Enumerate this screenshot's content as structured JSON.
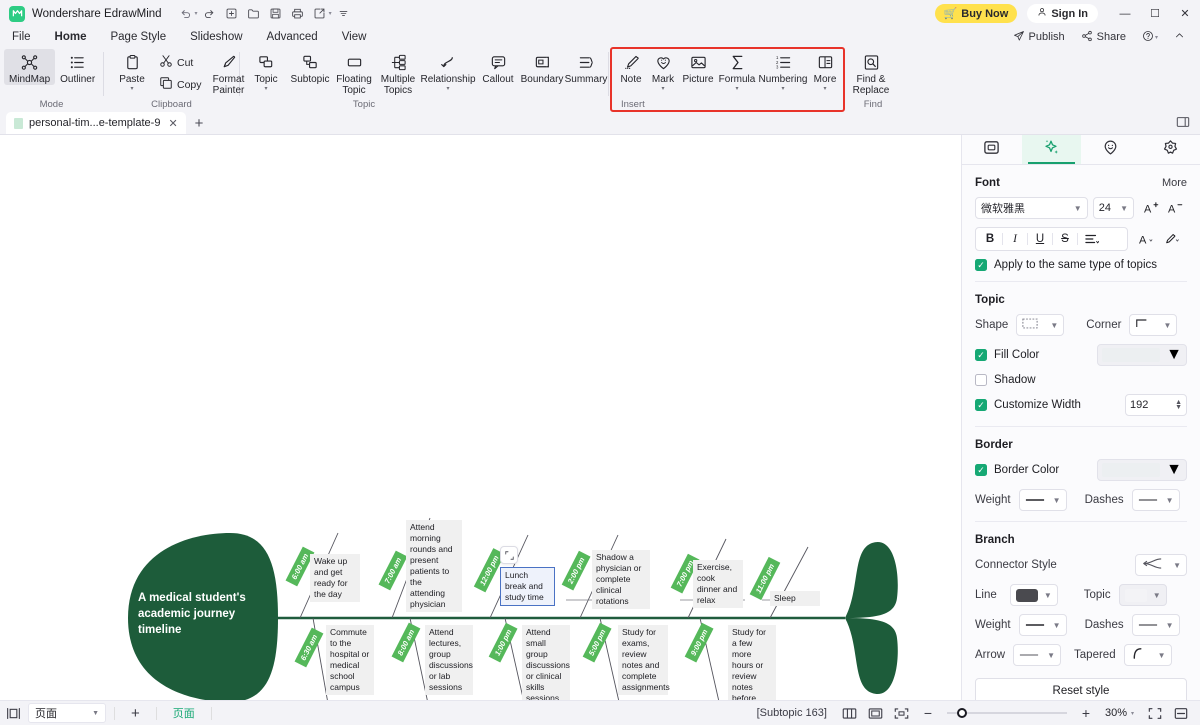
{
  "titlebar": {
    "logo_text": "M",
    "app_title": "Wondershare EdrawMind",
    "qat": [
      {
        "name": "undo-icon",
        "glyph": "↶"
      },
      {
        "name": "undo-dropdown-icon",
        "glyph": "▾"
      },
      {
        "name": "redo-icon",
        "glyph": "↷"
      },
      {
        "name": "new-icon",
        "glyph": "⊞"
      },
      {
        "name": "open-icon",
        "glyph": "🗁"
      },
      {
        "name": "save-icon",
        "glyph": "🖫"
      },
      {
        "name": "print-icon",
        "glyph": "🖶"
      },
      {
        "name": "export-icon",
        "glyph": "↗"
      },
      {
        "name": "export-dropdown-icon",
        "glyph": "▾"
      },
      {
        "name": "qat-more-icon",
        "glyph": "⩲"
      }
    ],
    "buy_now": "Buy Now",
    "sign_in": "Sign In",
    "minimize": "—",
    "maximize": "☐",
    "close": "✕"
  },
  "menubar": {
    "items": [
      {
        "label": "File",
        "active": false
      },
      {
        "label": "Home",
        "active": true
      },
      {
        "label": "Page Style",
        "active": false
      },
      {
        "label": "Slideshow",
        "active": false
      },
      {
        "label": "Advanced",
        "active": false
      },
      {
        "label": "View",
        "active": false
      }
    ],
    "right": [
      {
        "label": "Publish",
        "icon": "publish-icon"
      },
      {
        "label": "Share",
        "icon": "share-icon"
      },
      {
        "label": "",
        "icon": "help-icon"
      },
      {
        "label": "",
        "icon": "collapse-ribbon-icon"
      }
    ]
  },
  "ribbon": {
    "groups": [
      {
        "label": "Mode",
        "buttons": [
          {
            "label": "MindMap",
            "icon": "mindmap-icon",
            "active": true
          },
          {
            "label": "Outliner",
            "icon": "outliner-icon",
            "active": false
          }
        ]
      },
      {
        "label": "Clipboard",
        "buttons": [
          {
            "label": "Paste",
            "icon": "paste-icon",
            "dropdown": true
          },
          {
            "label": "Cut",
            "icon": "cut-icon"
          },
          {
            "label": "Copy",
            "icon": "copy-icon"
          },
          {
            "label": "Format Painter",
            "icon": "format-painter-icon"
          }
        ]
      },
      {
        "label": "Topic",
        "buttons": [
          {
            "label": "Topic",
            "icon": "topic-icon",
            "dropdown": true
          },
          {
            "label": "Subtopic",
            "icon": "subtopic-icon"
          },
          {
            "label": "Floating Topic",
            "icon": "floating-topic-icon"
          },
          {
            "label": "Multiple Topics",
            "icon": "multiple-topics-icon"
          },
          {
            "label": "Relationship",
            "icon": "relationship-icon",
            "dropdown": true
          },
          {
            "label": "Callout",
            "icon": "callout-icon"
          },
          {
            "label": "Boundary",
            "icon": "boundary-icon"
          },
          {
            "label": "Summary",
            "icon": "summary-icon"
          }
        ]
      },
      {
        "label": "Insert",
        "highlighted": true,
        "buttons": [
          {
            "label": "Note",
            "icon": "note-icon"
          },
          {
            "label": "Mark",
            "icon": "mark-icon",
            "dropdown": true
          },
          {
            "label": "Picture",
            "icon": "picture-icon"
          },
          {
            "label": "Formula",
            "icon": "formula-icon",
            "dropdown": true
          },
          {
            "label": "Numbering",
            "icon": "numbering-icon",
            "dropdown": true
          },
          {
            "label": "More",
            "icon": "more-icon",
            "dropdown": true
          }
        ]
      },
      {
        "label": "Find",
        "buttons": [
          {
            "label": "Find & Replace",
            "icon": "find-replace-icon"
          }
        ]
      }
    ]
  },
  "doctabs": {
    "tabs": [
      {
        "label": "personal-tim...e-template-9",
        "close": "✕"
      }
    ],
    "add": "+",
    "right_panel_toggle": "panel-toggle-icon"
  },
  "panel": {
    "tabs": [
      {
        "name": "layout-tab",
        "icon": "layout-icon",
        "active": false
      },
      {
        "name": "style-tab",
        "icon": "sparkle-icon",
        "active": true
      },
      {
        "name": "mark-tab",
        "icon": "smiley-icon",
        "active": false
      },
      {
        "name": "theme-tab",
        "icon": "flower-icon",
        "active": false
      }
    ],
    "font": {
      "title": "Font",
      "more": "More",
      "family": "微软雅黑",
      "size": "24",
      "increase_label": "A",
      "decrease_label": "A",
      "bold": "B",
      "italic": "I",
      "underline": "U",
      "strike": "S",
      "align": "≡",
      "text_color": "A",
      "highlight": "✏",
      "apply_same_label": "Apply to the same type of topics",
      "apply_same_checked": true
    },
    "topic": {
      "title": "Topic",
      "shape_label": "Shape",
      "corner_label": "Corner",
      "fill_color_label": "Fill Color",
      "fill_color_checked": true,
      "shadow_label": "Shadow",
      "shadow_checked": false,
      "customize_width_label": "Customize Width",
      "customize_width_checked": true,
      "width_value": "192"
    },
    "border": {
      "title": "Border",
      "border_color_label": "Border Color",
      "border_color_checked": true,
      "weight_label": "Weight",
      "dashes_label": "Dashes"
    },
    "branch": {
      "title": "Branch",
      "connector_style_label": "Connector Style",
      "line_label": "Line",
      "line_color": "#4a4a4f",
      "topic_label": "Topic",
      "weight_label": "Weight",
      "dashes_label": "Dashes",
      "arrow_label": "Arrow",
      "tapered_label": "Tapered",
      "reset_label": "Reset style"
    }
  },
  "statusbar": {
    "view_icon": "page-view-icon",
    "page_select": "页面",
    "add": "+",
    "page_chip": "页面",
    "subtopic_info": "[Subtopic 163]",
    "icons": [
      {
        "name": "two-page-view-icon",
        "glyph": "▥"
      },
      {
        "name": "fit-page-icon",
        "glyph": "▣"
      },
      {
        "name": "fit-selection-icon",
        "glyph": "⛶"
      }
    ],
    "zoom_out": "−",
    "zoom_in": "+",
    "zoom_pct": "30%",
    "fullscreen_icon": "fullscreen-icon",
    "minimap_icon": "minimap-icon"
  },
  "diagram": {
    "type": "fishbone",
    "central_topic": "A medical student's\nacademic journey\ntimeline",
    "spine_color": "#1f5c3d",
    "head_color": "#1d5c3a",
    "tag_color": "#55b85a",
    "nodes": [
      {
        "time": "6:00 am",
        "text": "Wake up and get ready for the day",
        "side": "top"
      },
      {
        "time": "6:30 am",
        "text": "Commute to the hospital or medical school campus",
        "side": "bottom"
      },
      {
        "time": "7:00 am",
        "text": "Attend morning rounds and present patients to the attending physician",
        "side": "top"
      },
      {
        "time": "8:00 am",
        "text": "Attend lectures, group discussions or lab sessions",
        "side": "bottom"
      },
      {
        "time": "12:00 pm",
        "text": "Lunch break and study time",
        "side": "top",
        "selected": true
      },
      {
        "time": "1:00 pm",
        "text": "Attend small group discussions or clinical skills sessions",
        "side": "bottom"
      },
      {
        "time": "2:00 pm",
        "text": "Shadow a physician or complete clinical rotations",
        "side": "top"
      },
      {
        "time": "5:00 pm",
        "text": "Study for exams, review notes and complete assignments",
        "side": "bottom"
      },
      {
        "time": "7:00 pm",
        "text": "Exercise, cook dinner and relax",
        "side": "top"
      },
      {
        "time": "9:00 pm",
        "text": "Study for a few more hours or review notes before bed",
        "side": "bottom"
      },
      {
        "time": "11:00 pm",
        "text": "Sleep",
        "side": "top"
      }
    ]
  }
}
